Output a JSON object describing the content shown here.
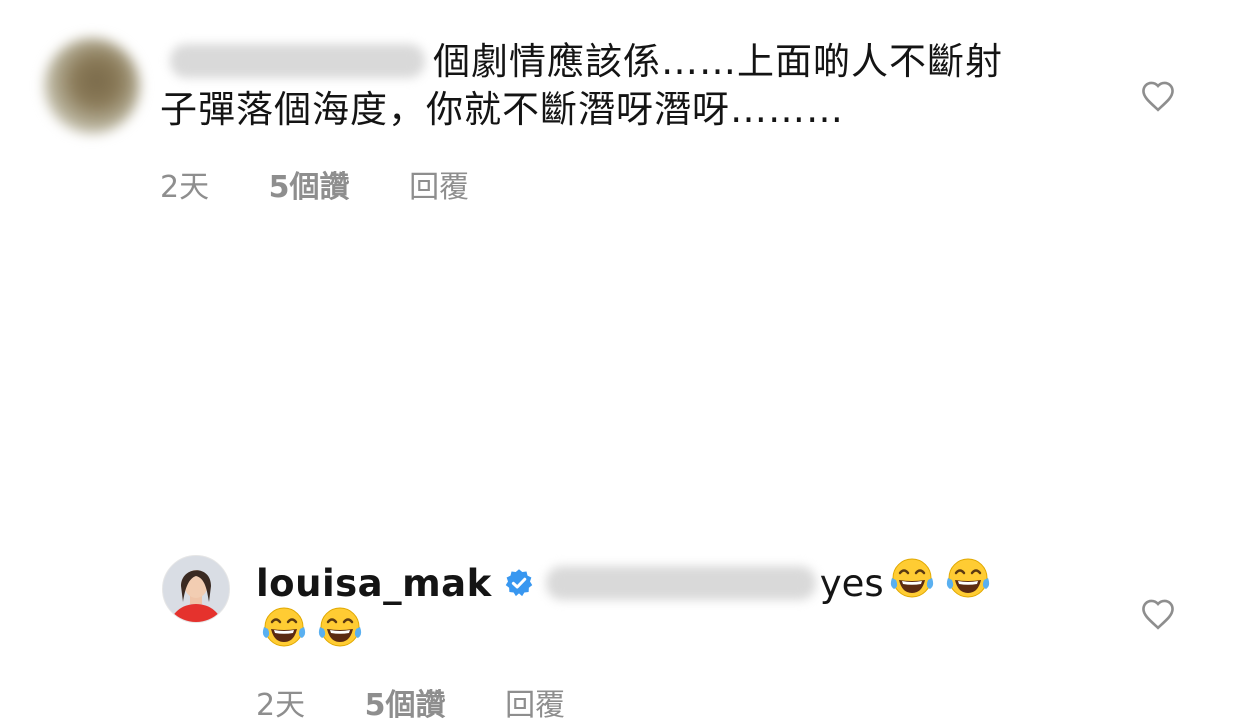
{
  "comment1": {
    "text_line1": "個劇情應該係……上面啲人不斷射",
    "text_line2": "子彈落個海度，你就不斷潛呀潛呀………",
    "time": "2天",
    "likes": "5個讚",
    "reply": "回覆"
  },
  "comment2": {
    "username": "louisa_mak",
    "text": "yes",
    "time": "2天",
    "likes": "5個讚",
    "reply": "回覆"
  },
  "colors": {
    "meta_gray": "#8e8e8e",
    "verified_blue": "#3897f0",
    "text": "#141414"
  },
  "icons": [
    "heart-outline-icon",
    "verified-badge-icon",
    "laughing-tears-emoji"
  ]
}
